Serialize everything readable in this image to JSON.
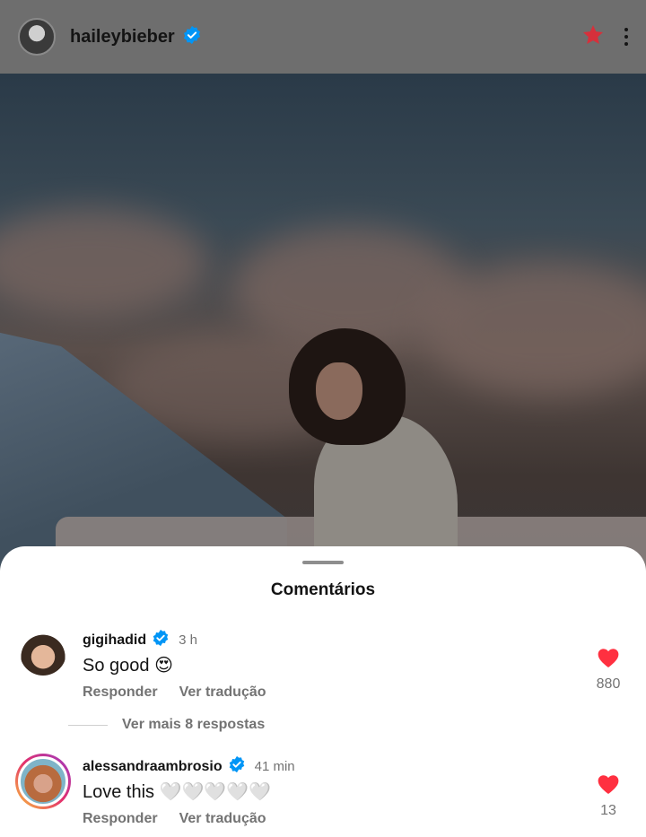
{
  "header": {
    "username": "haileybieber",
    "verified": true,
    "icons": [
      "avatar",
      "verified-badge-icon",
      "star-icon",
      "more-icon"
    ]
  },
  "comments_sheet": {
    "title": "Comentários",
    "comments": [
      {
        "username": "gigihadid",
        "verified": true,
        "time": "3 h",
        "text": "So good 😍",
        "reply_label": "Responder",
        "translate_label": "Ver tradução",
        "like_count": "880"
      },
      {
        "username": "alessandraambrosio",
        "verified": true,
        "time": "41 min",
        "text": "Love this 🤍🤍🤍🤍🤍",
        "reply_label": "Responder",
        "translate_label": "Ver tradução",
        "like_count": "13"
      }
    ],
    "more_replies": "Ver mais 8 respostas"
  },
  "colors": {
    "verified_blue": "#0095f6",
    "like_red": "#ff3040",
    "star_red": "#e0313f",
    "muted_text": "#737373"
  }
}
